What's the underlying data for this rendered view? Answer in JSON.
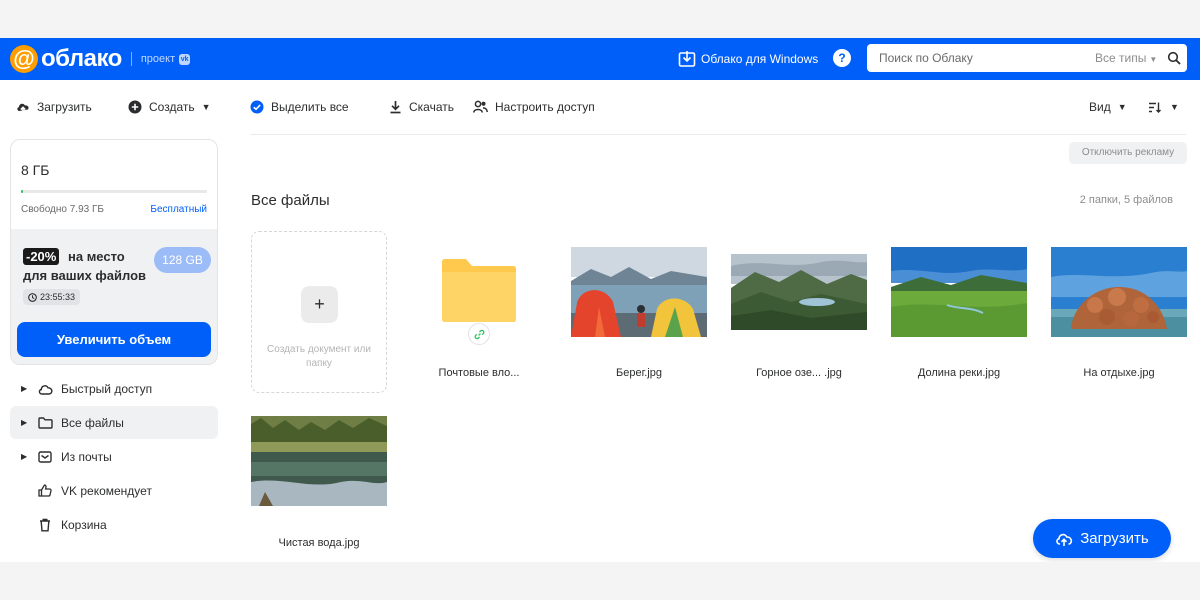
{
  "header": {
    "logo_symbol": "@",
    "logo_text": "облако",
    "project_label": "проект",
    "project_badge": "vk",
    "windows_link": "Облако для Windows",
    "help_label": "?",
    "search_placeholder": "Поиск по Облаку",
    "search_types": "Все типы",
    "colors": {
      "header_bg": "#005ff9",
      "logo_accent": "#ff9e00"
    }
  },
  "toolbar": {
    "upload": "Загрузить",
    "create": "Создать",
    "select_all": "Выделить все",
    "download": "Скачать",
    "share": "Настроить доступ",
    "view": "Вид",
    "sort_icon": "sort-icon"
  },
  "storage": {
    "total": "8 ГБ",
    "used_fraction": 0.01,
    "free": "Свободно 7.93 ГБ",
    "plan": "Бесплатный",
    "promo": {
      "discount": "-20%",
      "line1": "на место",
      "line2": "для ваших файлов",
      "size": "128 GB",
      "timer": "23:55:33",
      "button": "Увеличить объем"
    }
  },
  "sidebar": {
    "items": [
      {
        "label": "Быстрый доступ",
        "icon": "cloud-icon",
        "arrow": true,
        "active": false
      },
      {
        "label": "Все файлы",
        "icon": "folder-icon",
        "arrow": true,
        "active": true
      },
      {
        "label": "Из почты",
        "icon": "mail-icon",
        "arrow": true,
        "active": false
      },
      {
        "label": "VK рекомендует",
        "icon": "thumbs-up-icon",
        "arrow": false,
        "active": false
      },
      {
        "label": "Корзина",
        "icon": "trash-icon",
        "arrow": false,
        "active": false
      }
    ]
  },
  "main": {
    "ad_button": "Отключить рекламу",
    "title": "Все файлы",
    "count": "2 папки, 5 файлов",
    "create_tile": {
      "label": "Создать документ или папку",
      "plus": "+"
    },
    "files": [
      {
        "name": "Почтовые вло...",
        "type": "folder"
      },
      {
        "name": "Берег.jpg",
        "type": "image"
      },
      {
        "name": "Горное озе... .jpg",
        "type": "image"
      },
      {
        "name": "Долина реки.jpg",
        "type": "image"
      },
      {
        "name": "На отдыхе.jpg",
        "type": "image"
      },
      {
        "name": "Чистая вода.jpg",
        "type": "image"
      }
    ],
    "upload_fab": "Загрузить"
  }
}
